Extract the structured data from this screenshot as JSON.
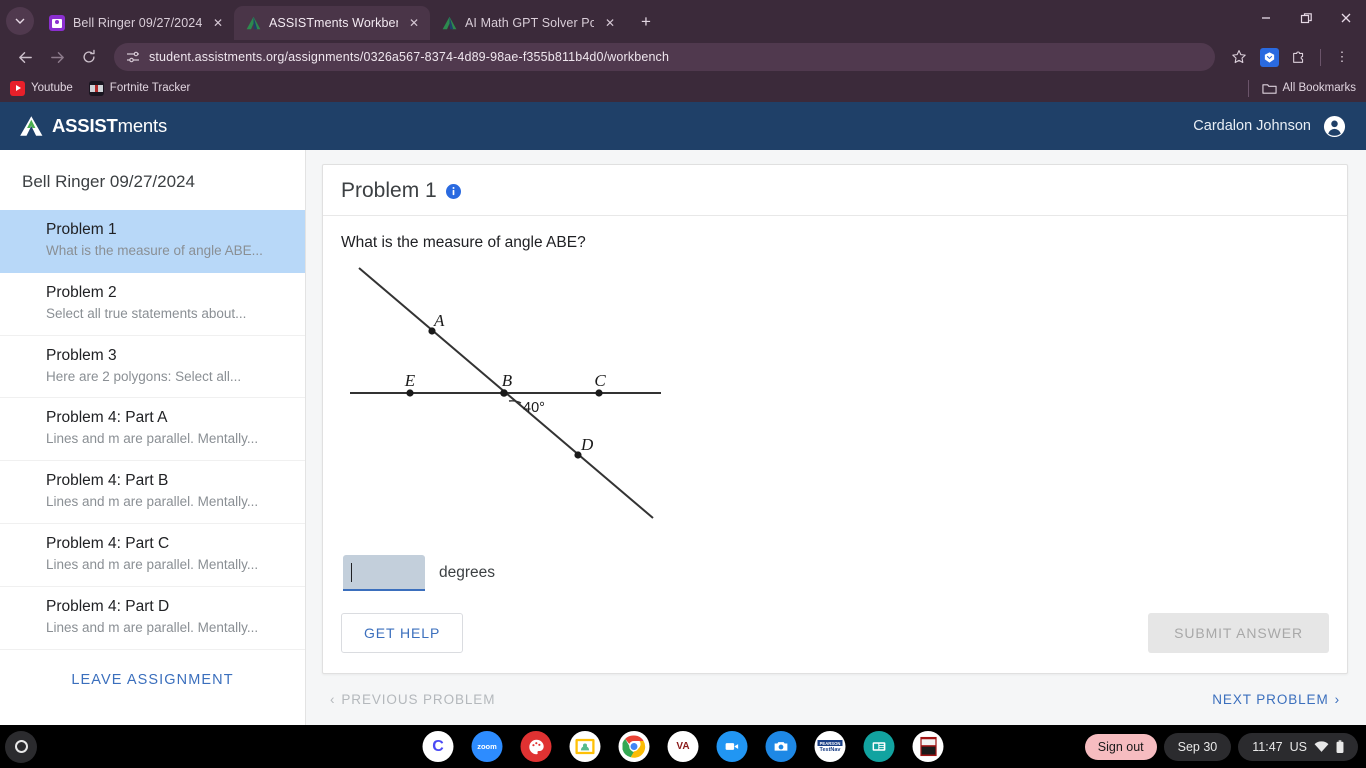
{
  "browser": {
    "tabs": [
      {
        "title": "Bell Ringer 09/27/2024",
        "favicon": "classroom-icon",
        "active": false
      },
      {
        "title": "ASSISTments Workbench",
        "favicon": "assistments-icon",
        "active": true
      },
      {
        "title": "AI Math GPT Solver Powered b",
        "favicon": "assistments-icon",
        "active": false
      }
    ],
    "new_tab_label": "+",
    "tab_list_chevron": "⌄",
    "window_controls": {
      "minimize": "–",
      "restore": "❐",
      "close": "✕"
    },
    "nav": {
      "back": "←",
      "forward": "→",
      "reload": "↻"
    },
    "omnibox": {
      "site_settings_icon": "tune-icon",
      "url": "student.assistments.org/assignments/0326a567-8374-4d89-98ae-f355b811b4d0/workbench"
    },
    "toolbar_icons": {
      "bookmark_star": "☆",
      "extension_blue": "extension-icon",
      "extensions_puzzle": "⬚",
      "menu": "⋮"
    },
    "bookmarks": [
      {
        "label": "Youtube",
        "icon": "youtube-icon"
      },
      {
        "label": "Fortnite Tracker",
        "icon": "fortnite-tracker-icon"
      }
    ],
    "all_bookmarks_label": "All Bookmarks"
  },
  "app": {
    "brand_bold": "ASSIST",
    "brand_light": "ments",
    "user_name": "Cardalon Johnson",
    "header_color": "#1f4068",
    "accent_color": "#3b6fbd"
  },
  "sidebar": {
    "assignment_title": "Bell Ringer 09/27/2024",
    "problems": [
      {
        "name": "Problem 1",
        "desc": "What is the measure of angle ABE...",
        "active": true
      },
      {
        "name": "Problem 2",
        "desc": "Select all true statements about...",
        "active": false
      },
      {
        "name": "Problem 3",
        "desc": "Here are 2 polygons: Select all...",
        "active": false
      },
      {
        "name": "Problem 4: Part A",
        "desc": "Lines  and m are parallel. Mentally...",
        "active": false
      },
      {
        "name": "Problem 4: Part B",
        "desc": "Lines  and m are parallel. Mentally...",
        "active": false
      },
      {
        "name": "Problem 4: Part C",
        "desc": "Lines  and m are parallel. Mentally...",
        "active": false
      },
      {
        "name": "Problem 4: Part D",
        "desc": "Lines  and m are parallel. Mentally...",
        "active": false
      }
    ],
    "leave_label": "LEAVE ASSIGNMENT"
  },
  "problem": {
    "title": "Problem 1",
    "info_icon": "info-icon",
    "question": "What is the measure of angle ABE?",
    "figure": {
      "type": "geometry-diagram",
      "description": "Two intersecting lines: horizontal line through E, B, C and a diagonal line through A, B, D crossing at B.",
      "point_labels": [
        "A",
        "E",
        "B",
        "C",
        "D"
      ],
      "angle_label": "40°",
      "angle_between": "ray BD and ray BC"
    },
    "answer": {
      "value": "",
      "unit_label": "degrees",
      "focused": true
    },
    "get_help_label": "GET HELP",
    "submit_label": "SUBMIT ANSWER",
    "submit_disabled": true,
    "prev_label": "PREVIOUS PROBLEM",
    "prev_disabled": true,
    "next_label": "NEXT PROBLEM",
    "prev_chevron": "‹",
    "next_chevron": "›"
  },
  "shelf": {
    "launcher": "launcher-icon",
    "apps": [
      {
        "name": "clever-icon",
        "letter": "C",
        "bg": "#ffffff",
        "fg": "#4a4af4",
        "open": false
      },
      {
        "name": "zoom-icon",
        "letter": "zoom",
        "bg": "#2d8cff",
        "fg": "#ffffff",
        "open": false
      },
      {
        "name": "art-palette-icon",
        "letter": "",
        "bg": "#e03232",
        "fg": "#ffffff",
        "open": false
      },
      {
        "name": "google-classroom-icon",
        "letter": "",
        "bg": "#ffffff",
        "fg": "#3c8f3c",
        "open": true
      },
      {
        "name": "google-chrome-icon",
        "letter": "",
        "bg": "#ffffff",
        "fg": "#4285f4",
        "open": true
      },
      {
        "name": "va-school-icon",
        "letter": "VA",
        "bg": "#ffffff",
        "fg": "#8b1a1a",
        "open": false
      },
      {
        "name": "video-camera-icon",
        "letter": "",
        "bg": "#2196f3",
        "fg": "#ffffff",
        "open": false
      },
      {
        "name": "camera-icon",
        "letter": "",
        "bg": "#1e88e5",
        "fg": "#ffffff",
        "open": false
      },
      {
        "name": "pearson-testnav-icon",
        "letter": "TestNav",
        "bg": "#ffffff",
        "fg": "#1a3f86",
        "open": false
      },
      {
        "name": "presentation-icon",
        "letter": "",
        "bg": "#12a3a0",
        "fg": "#ffffff",
        "open": false
      },
      {
        "name": "book-icon",
        "letter": "",
        "bg": "#ffffff",
        "fg": "#b01818",
        "open": false
      }
    ],
    "sign_out_label": "Sign out",
    "date": "Sep 30",
    "time": "11:47",
    "locale": "US",
    "wifi_icon": "wifi-icon",
    "battery_icon": "battery-icon"
  }
}
